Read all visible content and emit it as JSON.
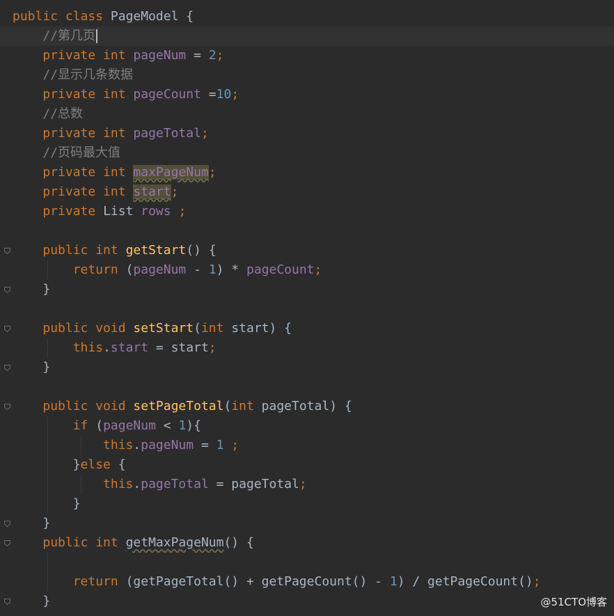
{
  "editor": {
    "lines": [
      [
        {
          "t": "public class ",
          "c": "kw"
        },
        {
          "t": "PageModel {",
          "c": "plain"
        }
      ],
      [
        {
          "t": "    "
        },
        {
          "t": "//第几页",
          "c": "comment"
        }
      ],
      [
        {
          "t": "    "
        },
        {
          "t": "private int ",
          "c": "kw"
        },
        {
          "t": "pageNum",
          "c": "field"
        },
        {
          "t": " = ",
          "c": "plain"
        },
        {
          "t": "2",
          "c": "num"
        },
        {
          "t": ";",
          "c": "punct"
        }
      ],
      [
        {
          "t": "    "
        },
        {
          "t": "//显示几条数据",
          "c": "comment"
        }
      ],
      [
        {
          "t": "    "
        },
        {
          "t": "private int ",
          "c": "kw"
        },
        {
          "t": "pageCount",
          "c": "field"
        },
        {
          "t": " =",
          "c": "plain"
        },
        {
          "t": "10",
          "c": "num"
        },
        {
          "t": ";",
          "c": "punct"
        }
      ],
      [
        {
          "t": "    "
        },
        {
          "t": "//总数",
          "c": "comment"
        }
      ],
      [
        {
          "t": "    "
        },
        {
          "t": "private int ",
          "c": "kw"
        },
        {
          "t": "pageTotal",
          "c": "field"
        },
        {
          "t": ";",
          "c": "punct"
        }
      ],
      [
        {
          "t": "    "
        },
        {
          "t": "//页码最大值",
          "c": "comment"
        }
      ],
      [
        {
          "t": "    "
        },
        {
          "t": "private int ",
          "c": "kw"
        },
        {
          "t": "maxPageNum",
          "c": "field",
          "warn": true
        },
        {
          "t": ";",
          "c": "punct"
        }
      ],
      [
        {
          "t": "    "
        },
        {
          "t": "private int ",
          "c": "kw"
        },
        {
          "t": "start",
          "c": "field",
          "warn": true
        },
        {
          "t": ";",
          "c": "punct"
        }
      ],
      [
        {
          "t": "    "
        },
        {
          "t": "private ",
          "c": "kw"
        },
        {
          "t": "List ",
          "c": "plain"
        },
        {
          "t": "rows",
          "c": "field"
        },
        {
          "t": " ;",
          "c": "punct"
        }
      ],
      [],
      [
        {
          "t": "    "
        },
        {
          "t": "public int ",
          "c": "kw"
        },
        {
          "t": "getStart",
          "c": "method"
        },
        {
          "t": "() {",
          "c": "plain"
        }
      ],
      [
        {
          "t": "        "
        },
        {
          "t": "return ",
          "c": "kw"
        },
        {
          "t": "(",
          "c": "plain"
        },
        {
          "t": "pageNum",
          "c": "field"
        },
        {
          "t": " - ",
          "c": "plain"
        },
        {
          "t": "1",
          "c": "num"
        },
        {
          "t": ") * ",
          "c": "plain"
        },
        {
          "t": "pageCount",
          "c": "field"
        },
        {
          "t": ";",
          "c": "punct"
        }
      ],
      [
        {
          "t": "    "
        },
        {
          "t": "}",
          "c": "plain"
        }
      ],
      [],
      [
        {
          "t": "    "
        },
        {
          "t": "public void ",
          "c": "kw"
        },
        {
          "t": "setStart",
          "c": "method"
        },
        {
          "t": "(",
          "c": "plain"
        },
        {
          "t": "int ",
          "c": "kw"
        },
        {
          "t": "start) {",
          "c": "plain"
        }
      ],
      [
        {
          "t": "        "
        },
        {
          "t": "this",
          "c": "kw"
        },
        {
          "t": ".",
          "c": "plain"
        },
        {
          "t": "start",
          "c": "field"
        },
        {
          "t": " = start",
          "c": "plain"
        },
        {
          "t": ";",
          "c": "punct"
        }
      ],
      [
        {
          "t": "    "
        },
        {
          "t": "}",
          "c": "plain"
        }
      ],
      [],
      [
        {
          "t": "    "
        },
        {
          "t": "public void ",
          "c": "kw"
        },
        {
          "t": "setPageTotal",
          "c": "method"
        },
        {
          "t": "(",
          "c": "plain"
        },
        {
          "t": "int ",
          "c": "kw"
        },
        {
          "t": "pageTotal) {",
          "c": "plain"
        }
      ],
      [
        {
          "t": "        "
        },
        {
          "t": "if ",
          "c": "kw"
        },
        {
          "t": "(",
          "c": "plain"
        },
        {
          "t": "pageNum",
          "c": "field"
        },
        {
          "t": " < ",
          "c": "plain"
        },
        {
          "t": "1",
          "c": "num"
        },
        {
          "t": "){",
          "c": "plain"
        }
      ],
      [
        {
          "t": "            "
        },
        {
          "t": "this",
          "c": "kw"
        },
        {
          "t": ".",
          "c": "plain"
        },
        {
          "t": "pageNum",
          "c": "field"
        },
        {
          "t": " = ",
          "c": "plain"
        },
        {
          "t": "1",
          "c": "num"
        },
        {
          "t": " ;",
          "c": "punct"
        }
      ],
      [
        {
          "t": "        "
        },
        {
          "t": "}",
          "c": "plain"
        },
        {
          "t": "else ",
          "c": "kw"
        },
        {
          "t": "{",
          "c": "plain"
        }
      ],
      [
        {
          "t": "            "
        },
        {
          "t": "this",
          "c": "kw"
        },
        {
          "t": ".",
          "c": "plain"
        },
        {
          "t": "pageTotal",
          "c": "field"
        },
        {
          "t": " = pageTotal",
          "c": "plain"
        },
        {
          "t": ";",
          "c": "punct"
        }
      ],
      [
        {
          "t": "        "
        },
        {
          "t": "}",
          "c": "plain"
        }
      ],
      [
        {
          "t": "    "
        },
        {
          "t": "}",
          "c": "plain"
        }
      ],
      [
        {
          "t": "    "
        },
        {
          "t": "public int ",
          "c": "kw"
        },
        {
          "t": "getMaxPageNum",
          "c": "plain",
          "underline": true
        },
        {
          "t": "() {",
          "c": "plain"
        }
      ],
      [],
      [
        {
          "t": "        "
        },
        {
          "t": "return ",
          "c": "kw"
        },
        {
          "t": "(getPageTotal() + getPageCount() - ",
          "c": "plain"
        },
        {
          "t": "1",
          "c": "num"
        },
        {
          "t": ") / getPageCount()",
          "c": "plain"
        },
        {
          "t": ";",
          "c": "punct"
        }
      ],
      [
        {
          "t": "    "
        },
        {
          "t": "}",
          "c": "plain"
        }
      ]
    ]
  },
  "watermark": {
    "text": "@51CTO博客"
  }
}
